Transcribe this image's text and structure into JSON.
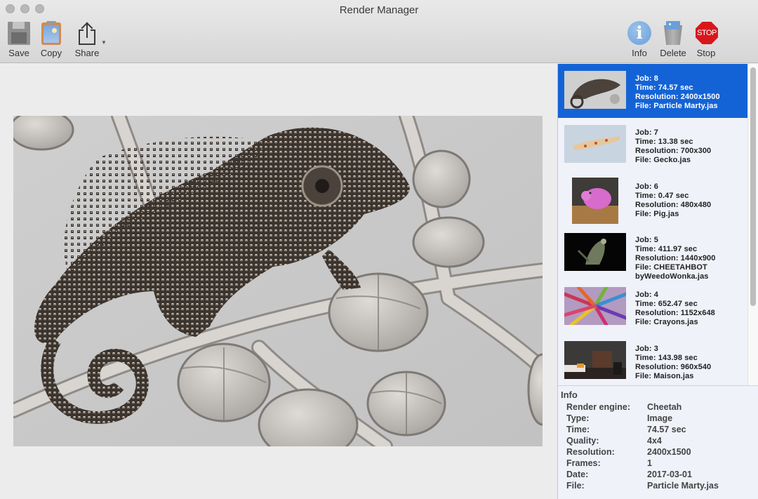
{
  "window": {
    "title": "Render Manager",
    "controls": [
      "close",
      "minimize",
      "zoom"
    ]
  },
  "toolbar": {
    "left": [
      {
        "id": "save",
        "label": "Save",
        "icon": "floppy-disk-icon"
      },
      {
        "id": "copy",
        "label": "Copy",
        "icon": "clipboard-icon"
      },
      {
        "id": "share",
        "label": "Share",
        "icon": "share-icon",
        "has_menu": true
      }
    ],
    "right": [
      {
        "id": "info",
        "label": "Info",
        "icon": "info-icon",
        "glyph": "i"
      },
      {
        "id": "delete",
        "label": "Delete",
        "icon": "trash-icon"
      },
      {
        "id": "stop",
        "label": "Stop",
        "icon": "stop-sign-icon",
        "glyph": "STOP"
      }
    ]
  },
  "main": {
    "preview_subject": "Particle Marty chameleon render"
  },
  "jobs": [
    {
      "job": "Job: 8",
      "time": "Time: 74.57 sec",
      "resolution": "Resolution: 2400x1500",
      "file": "File: Particle Marty.jas",
      "file2": "",
      "selected": true,
      "thumb": "chameleon"
    },
    {
      "job": "Job: 7",
      "time": "Time: 13.38 sec",
      "resolution": "Resolution: 700x300",
      "file": "File: Gecko.jas",
      "file2": "",
      "selected": false,
      "thumb": "gecko"
    },
    {
      "job": "Job: 6",
      "time": "Time: 0.47 sec",
      "resolution": "Resolution: 480x480",
      "file": "File: Pig.jas",
      "file2": "",
      "selected": false,
      "thumb": "pig"
    },
    {
      "job": "Job: 5",
      "time": "Time: 411.97 sec",
      "resolution": "Resolution: 1440x900",
      "file": "File: CHEETAHBOT",
      "file2": "byWeedoWonka.jas",
      "selected": false,
      "thumb": "cheetahbot"
    },
    {
      "job": "Job: 4",
      "time": "Time: 652.47 sec",
      "resolution": "Resolution: 1152x648",
      "file": "File: Crayons.jas",
      "file2": "",
      "selected": false,
      "thumb": "crayons"
    },
    {
      "job": "Job: 3",
      "time": "Time: 143.98 sec",
      "resolution": "Resolution: 960x540",
      "file": "File: Maison.jas",
      "file2": "",
      "selected": false,
      "thumb": "maison"
    }
  ],
  "info": {
    "title": "Info",
    "rows": [
      {
        "key": "Render engine:",
        "value": "Cheetah"
      },
      {
        "key": "Type:",
        "value": "Image"
      },
      {
        "key": "Time:",
        "value": "74.57 sec"
      },
      {
        "key": "Quality:",
        "value": "4x4"
      },
      {
        "key": "Resolution:",
        "value": "2400x1500"
      },
      {
        "key": "Frames:",
        "value": "1"
      },
      {
        "key": "Date:",
        "value": "2017-03-01"
      },
      {
        "key": "File:",
        "value": "Particle Marty.jas"
      }
    ]
  },
  "colors": {
    "selection": "#1463d6",
    "list_bg": "#eff2f9",
    "stop_red": "#d8171d",
    "info_blue": "#6a9fd8"
  }
}
